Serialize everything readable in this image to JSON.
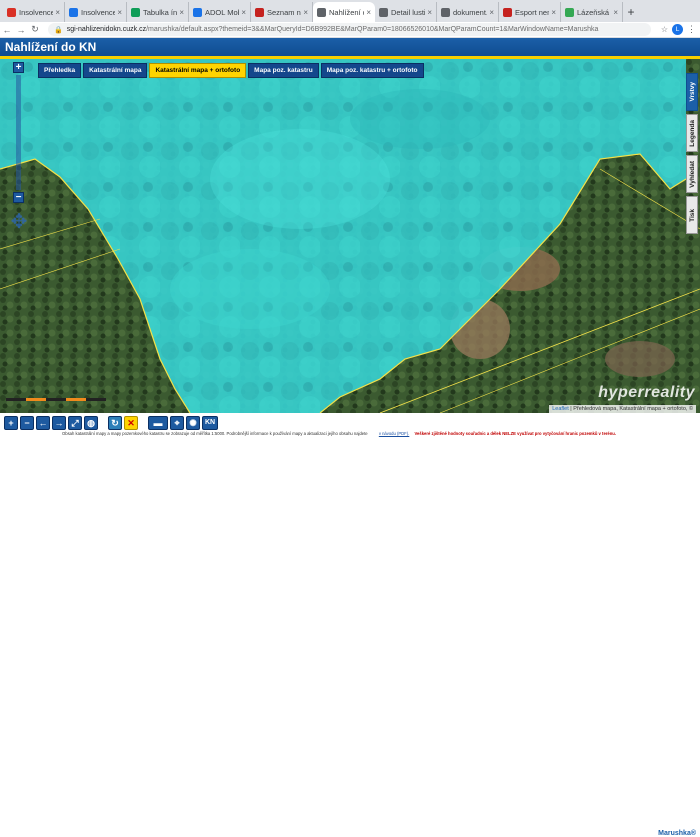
{
  "browser": {
    "tabs": [
      {
        "label": "Insolvence",
        "color": "#d93025",
        "active": false
      },
      {
        "label": "Insolvence",
        "color": "#1a73e8",
        "active": false
      },
      {
        "label": "Tabulka índi",
        "color": "#0f9d58",
        "active": false
      },
      {
        "label": "ADOL Mobil",
        "color": "#1a73e8",
        "active": false
      },
      {
        "label": "Seznam ne",
        "color": "#c5221f",
        "active": false
      },
      {
        "label": "Nahlížení d",
        "color": "#5f6368",
        "active": true
      },
      {
        "label": "Detail lusti",
        "color": "#5f6368",
        "active": false
      },
      {
        "label": "dokument.",
        "color": "#5f6368",
        "active": false
      },
      {
        "label": "Esport nem",
        "color": "#c5221f",
        "active": false
      },
      {
        "label": "Lázeňská 2",
        "color": "#34a853",
        "active": false
      }
    ],
    "tab_close": "×",
    "new_tab": "+",
    "url_host": "sgi-nahlizenidokn.cuzk.cz",
    "url_path": "/marushka/default.aspx?themeid=3&&MarQueryId=D6B992BE&MarQParam0=18066526010&MarQParamCount=1&MarWindowName=Marushka",
    "profile_initial": "L"
  },
  "app": {
    "title": "Nahlížení do KN"
  },
  "layers": {
    "buttons": [
      {
        "label": "Přehledka",
        "active": false
      },
      {
        "label": "Katastrální mapa",
        "active": false
      },
      {
        "label": "Katastrální mapa + ortofoto",
        "active": true
      },
      {
        "label": "Mapa poz. katastru",
        "active": false
      },
      {
        "label": "Mapa poz. katastru + ortofoto",
        "active": false
      }
    ]
  },
  "zoom": {
    "plus": "+",
    "minus": "−"
  },
  "side_tabs": [
    {
      "label": "Vrstvy",
      "active": true
    },
    {
      "label": "Legenda",
      "active": false
    },
    {
      "label": "Vyhledat",
      "active": false
    },
    {
      "label": "Tisk",
      "active": false
    }
  ],
  "attribution": {
    "leaflet": "Leaflet",
    "text": "| Přehledová mapa, Katastrální mapa + ortofoto, ©"
  },
  "watermark": "hyperreality",
  "bottom_tools": {
    "kn_label": "KN"
  },
  "footer": {
    "text": "Obsah katastrální mapy a mapy pozemkového katastru se zobrazuje od měřítka 1:5000. Podrobnější informace k používání mapy a aktualizaci jejího obsahu najdete",
    "link": "v návodu (PDF).",
    "warning": "Veškeré zjištěné hodnoty souřadnic a délek NELZE využívat pro vytyčování hranic pozemků v terénu.",
    "brand": "Marushka®"
  },
  "colors": {
    "highlight": "#39d4d4",
    "header": "#1b5fa8",
    "accent_yellow": "#ffd400"
  }
}
